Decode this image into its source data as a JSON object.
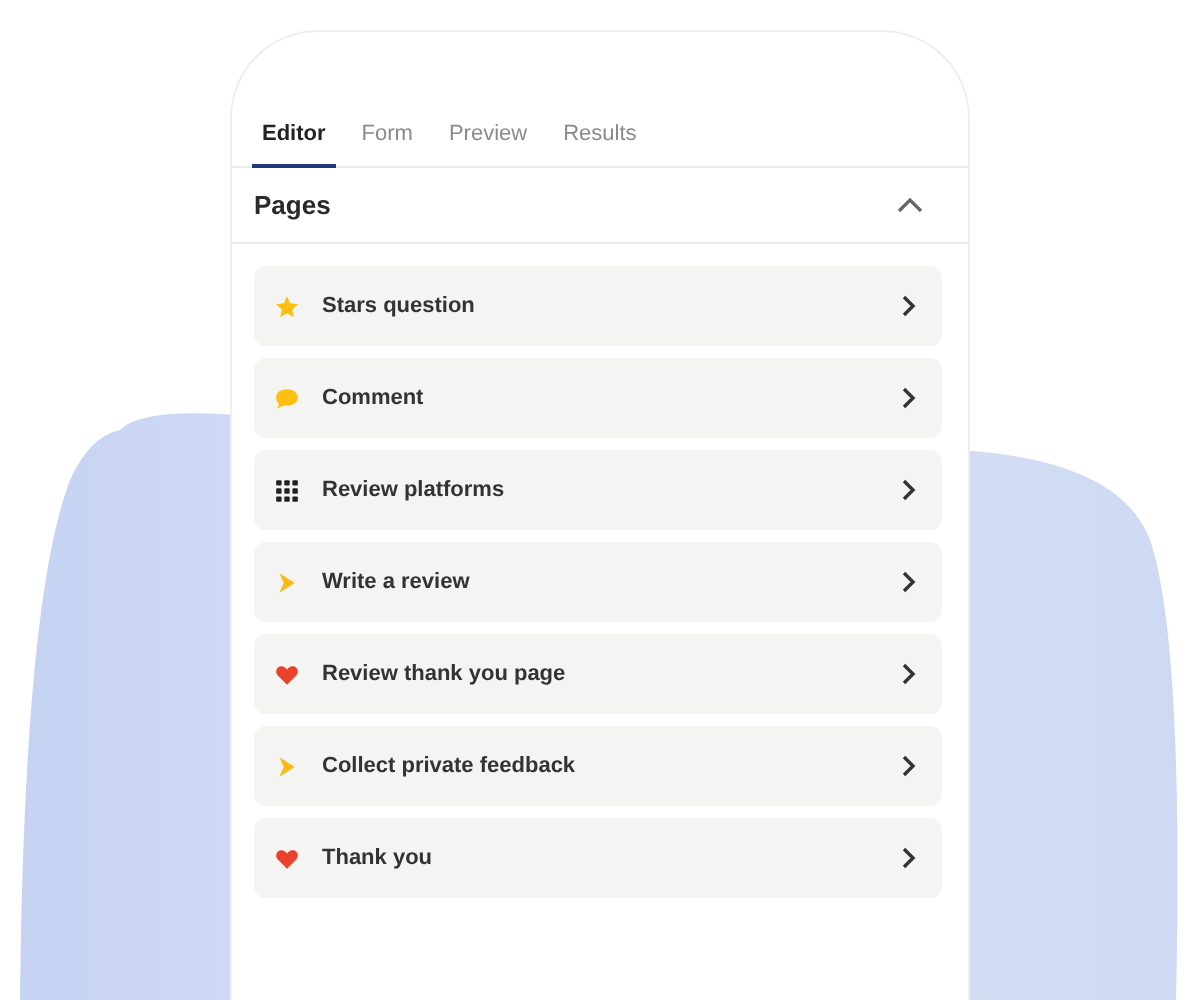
{
  "tabs": [
    {
      "label": "Editor",
      "selected": true
    },
    {
      "label": "Form",
      "selected": false
    },
    {
      "label": "Preview",
      "selected": false
    },
    {
      "label": "Results",
      "selected": false
    }
  ],
  "section": {
    "title": "Pages",
    "expanded": true
  },
  "pages": [
    {
      "label": "Stars question",
      "kind": "star"
    },
    {
      "label": "Comment",
      "kind": "comment"
    },
    {
      "label": "Review platforms",
      "kind": "grid"
    },
    {
      "label": "Write a review",
      "kind": "arrow"
    },
    {
      "label": "Review thank you page",
      "kind": "heart"
    },
    {
      "label": "Collect private feedback",
      "kind": "arrow"
    },
    {
      "label": "Thank you",
      "kind": "heart"
    }
  ]
}
